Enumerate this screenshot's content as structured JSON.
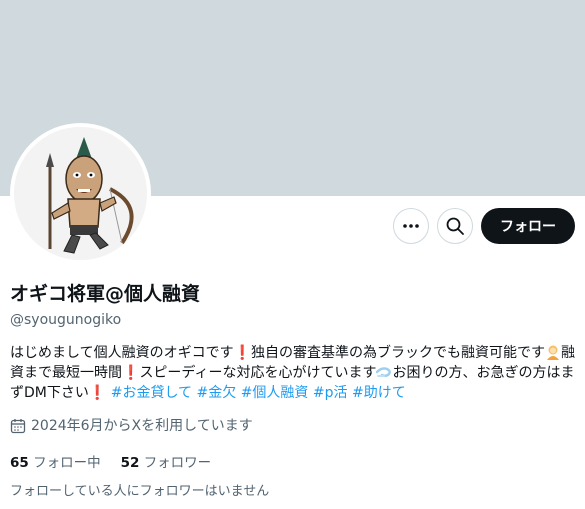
{
  "profile": {
    "display_name": "オギコ将軍@個人融資",
    "handle": "@syougunogiko",
    "follow_label": "フォロー",
    "bio_parts": {
      "p1": "はじめまして個人融資のオギコです",
      "p2": "独自の審査基準の為ブラックでも融資可能です",
      "p3": "融資まで最短一時間",
      "p4": "スピーディーな対応を心がけています",
      "p5": "お困りの方、お急ぎの方はまずDM下さい",
      "excl": "❗"
    },
    "hashtags": [
      "#お金貸して",
      "#金欠",
      "#個人融資",
      "#p活",
      "#助けて"
    ],
    "joined": "2024年6月からXを利用しています",
    "following_count": "65",
    "following_label": "フォロー中",
    "followers_count": "52",
    "followers_label": "フォロワー",
    "mutual_text": "フォローしている人にフォロワーはいません"
  },
  "icons": {
    "more": "more-horizontal-icon",
    "search": "search-icon",
    "calendar": "calendar-icon"
  },
  "colors": {
    "banner": "#cfd9de",
    "link": "#1d9bf0",
    "secondary_text": "#536471",
    "primary_text": "#0f1419",
    "follow_button": "#0f1419"
  }
}
